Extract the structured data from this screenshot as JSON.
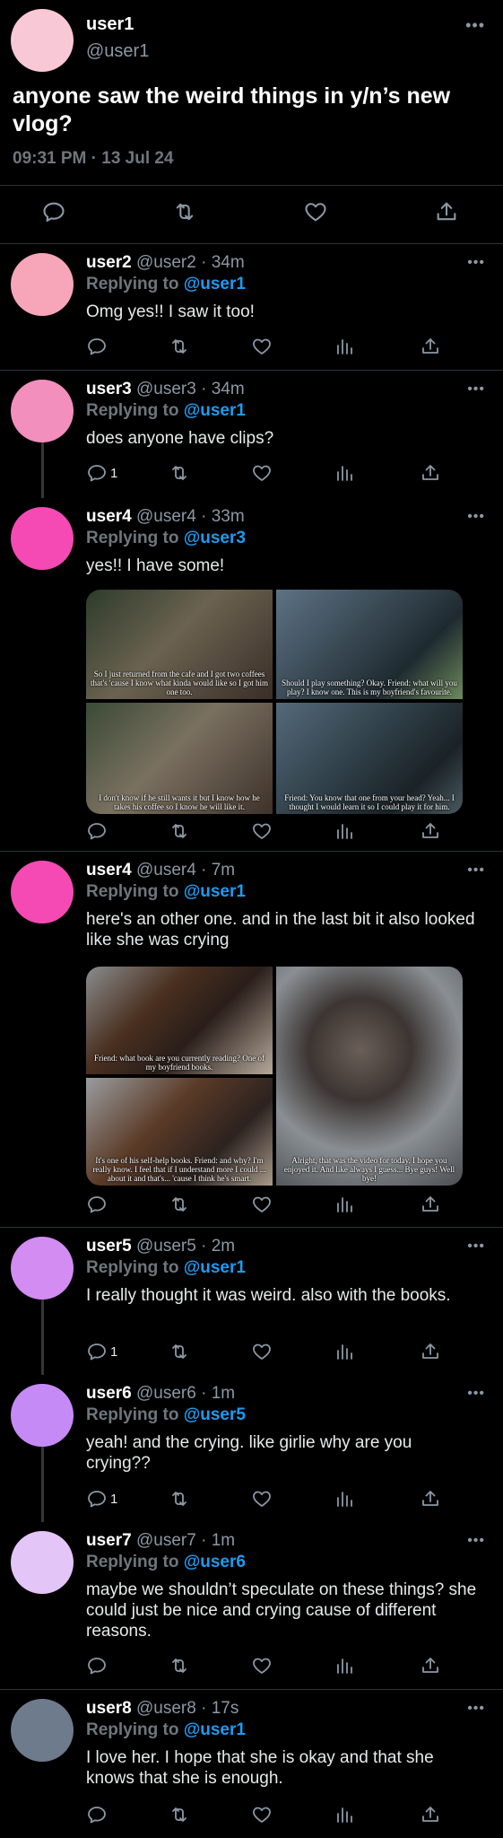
{
  "colors": {
    "accent": "#1d9bf0",
    "muted": "#8b98a5",
    "separator": "#2f3336"
  },
  "main_tweet": {
    "avatar_color": "#f9c8d6",
    "name": "user1",
    "handle": "@user1",
    "text": "anyone saw the weird things in y/n’s new vlog?",
    "timestamp": "09:31 PM · 13 Jul 24",
    "more_icon": "more-icon"
  },
  "replies": [
    {
      "name": "user2",
      "handle": "@user2",
      "time": "· 34m",
      "avatar_color": "#f7a6b9",
      "replying_label": "Replying to",
      "replying_to": "@user1",
      "text": "Omg yes!! I saw it too!",
      "reply_count": ""
    },
    {
      "name": "user3",
      "handle": "@user3",
      "time": "· 34m",
      "avatar_color": "#f28fbd",
      "replying_label": "Replying to",
      "replying_to": "@user1",
      "text": "does anyone have clips?",
      "reply_count": "1"
    },
    {
      "name": "user4",
      "handle": "@user4",
      "time": "· 33m",
      "avatar_color": "#f54ab3",
      "replying_label": "Replying to",
      "replying_to": "@user3",
      "text": "yes!! I have some!",
      "reply_count": "",
      "media_captions": [
        "So I just returned from the cafe and I got two coffees that's 'cause I know what kinda would like so I got him one too.",
        "Should I play something? Okay. Friend: what will you play? I know one. This is my boyfriend's favourite.",
        "I don't know if he still wants it but I know how he takes his coffee so I know he will like it.",
        "Friend: You know that one from your head? Yeah... I thought I would learn it so I could play it for him."
      ]
    },
    {
      "name": "user4",
      "handle": "@user4",
      "time": "· 7m",
      "avatar_color": "#f54ab3",
      "replying_label": "Replying to",
      "replying_to": "@user1",
      "text": "here's an other one. and in the last bit it also looked like she was crying",
      "reply_count": "",
      "media_captions": [
        "Friend: what book are you currently reading? One of my boyfriend books.",
        "It's one of his self-help books. Friend: and why? I'm really know. I feel that if I understand more I could ... about it and that's... 'cause I think he's smart.",
        "Alright, that was the video for today. I hope you enjoyed it. And like always I guess... Bye guys! Well bye!"
      ]
    },
    {
      "name": "user5",
      "handle": "@user5",
      "time": "· 2m",
      "avatar_color": "#d38cf2",
      "replying_label": "Replying to",
      "replying_to": "@user1",
      "text": "I really thought it was weird. also with the books.",
      "reply_count": "1"
    },
    {
      "name": "user6",
      "handle": "@user6",
      "time": "· 1m",
      "avatar_color": "#c68af7",
      "replying_label": "Replying to",
      "replying_to": "@user5",
      "text": "yeah! and the crying. like girlie why are you crying??",
      "reply_count": "1"
    },
    {
      "name": "user7",
      "handle": "@user7",
      "time": "· 1m",
      "avatar_color": "#e4c5f7",
      "replying_label": "Replying to",
      "replying_to": "@user6",
      "text": "maybe we shouldn’t speculate on these things? she could just be nice and crying cause of different reasons.",
      "reply_count": ""
    },
    {
      "name": "user8",
      "handle": "@user8",
      "time": "· 17s",
      "avatar_color": "#6d7b8c",
      "replying_label": "Replying to",
      "replying_to": "@user1",
      "text": "I love her. I hope that she is okay and that she knows that she is enough.",
      "reply_count": ""
    }
  ]
}
